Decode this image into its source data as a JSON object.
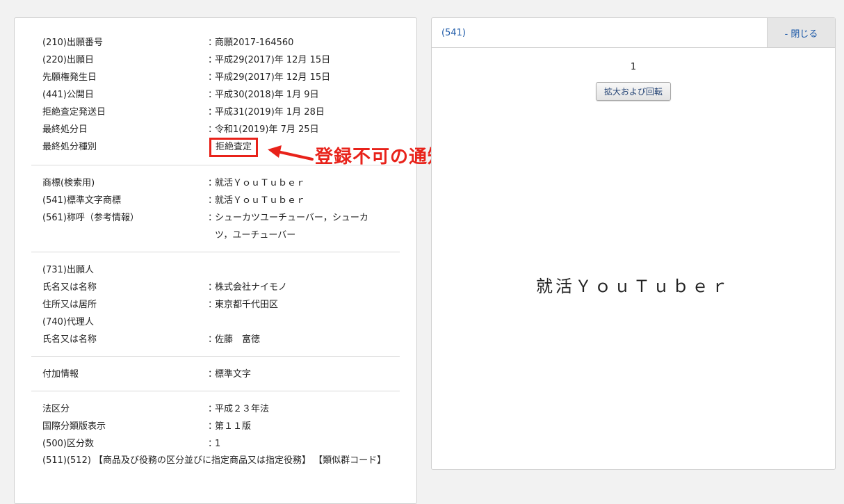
{
  "sections": [
    {
      "rows": [
        {
          "label": "(210)出願番号",
          "value": "商願2017-164560"
        },
        {
          "label": "(220)出願日",
          "value": "平成29(2017)年 12月 15日"
        },
        {
          "label": "先願権発生日",
          "value": "平成29(2017)年 12月 15日"
        },
        {
          "label": "(441)公開日",
          "value": "平成30(2018)年 1月 9日"
        },
        {
          "label": "拒絶査定発送日",
          "value": "平成31(2019)年 1月 28日"
        },
        {
          "label": "最終処分日",
          "value": "令和1(2019)年 7月 25日"
        },
        {
          "label": "最終処分種別",
          "value": "拒絶査定"
        }
      ]
    },
    {
      "rows": [
        {
          "label": "商標(検索用)",
          "value": "就活ＹｏｕＴｕｂｅｒ"
        },
        {
          "label": "(541)標準文字商標",
          "value": "就活ＹｏｕＴｕｂｅｒ"
        },
        {
          "label": "(561)称呼（参考情報）",
          "value": "シューカツユーチューバー，シューカツ，ユーチューバー"
        }
      ]
    },
    {
      "rows": [
        {
          "label": "(731)出願人",
          "value": ""
        },
        {
          "label": "氏名又は名称",
          "value": "株式会社ナイモノ"
        },
        {
          "label": "住所又は居所",
          "value": "東京都千代田区"
        },
        {
          "label": "(740)代理人",
          "value": ""
        },
        {
          "label": "氏名又は名称",
          "value": "佐藤　富徳"
        }
      ]
    },
    {
      "rows": [
        {
          "label": "付加情報",
          "value": "標準文字"
        }
      ]
    },
    {
      "rows": [
        {
          "label": "法区分",
          "value": "平成２３年法"
        },
        {
          "label": "国際分類版表示",
          "value": "第１１版"
        },
        {
          "label": "(500)区分数",
          "value": "1"
        }
      ],
      "footer": "(511)(512) 【商品及び役務の区分並びに指定商品又は指定役務】 【類似群コード】"
    }
  ],
  "colon": "：",
  "annotation": {
    "text": "登録不可の通知",
    "color": "#e8221a"
  },
  "image_panel": {
    "title": "(541)",
    "close_label": "- 閉じる",
    "page_number": "1",
    "zoom_rotate_label": "拡大および回転",
    "mark_text": "就活ＹｏｕＴｕｂｅｒ"
  },
  "colors": {
    "link": "#1e5aa8",
    "highlight": "#e8221a"
  }
}
